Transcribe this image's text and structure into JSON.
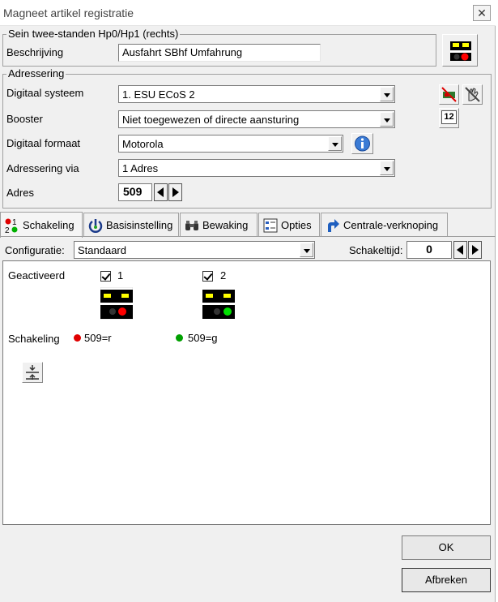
{
  "window": {
    "title": "Magneet artikel registratie",
    "close_glyph": "✕"
  },
  "signal_group": {
    "legend": "Sein twee-standen Hp0/Hp1 (rechts)",
    "beschrijving_label": "Beschrijving",
    "beschrijving_value": "Ausfahrt SBhf Umfahrung"
  },
  "adressering": {
    "legend": "Adressering",
    "digitaal_systeem_label": "Digitaal systeem",
    "digitaal_systeem_value": "1. ESU ECoS 2",
    "booster_label": "Booster",
    "booster_value": "Niet toegewezen of directe aansturing",
    "booster_badge": "12",
    "digitaal_formaat_label": "Digitaal formaat",
    "digitaal_formaat_value": "Motorola",
    "adressering_via_label": "Adressering via",
    "adressering_via_value": "1 Adres",
    "adres_label": "Adres",
    "adres_value": "509"
  },
  "tabs": [
    {
      "label": "Schakeling"
    },
    {
      "label": "Basisinstelling"
    },
    {
      "label": "Bewaking"
    },
    {
      "label": "Opties"
    },
    {
      "label": "Centrale-verknoping"
    }
  ],
  "schakeling": {
    "configuratie_label": "Configuratie:",
    "configuratie_value": "Standaard",
    "schakeltijd_label": "Schakeltijd:",
    "schakeltijd_value": "0",
    "geactiveerd_label": "Geactiveerd",
    "schakeling_label": "Schakeling",
    "positions": [
      {
        "number": "1",
        "address": "509=r",
        "dot_color": "#e00000"
      },
      {
        "number": "2",
        "address": "509=g",
        "dot_color": "#00a000"
      }
    ]
  },
  "buttons": {
    "ok": "OK",
    "cancel": "Afbreken"
  }
}
